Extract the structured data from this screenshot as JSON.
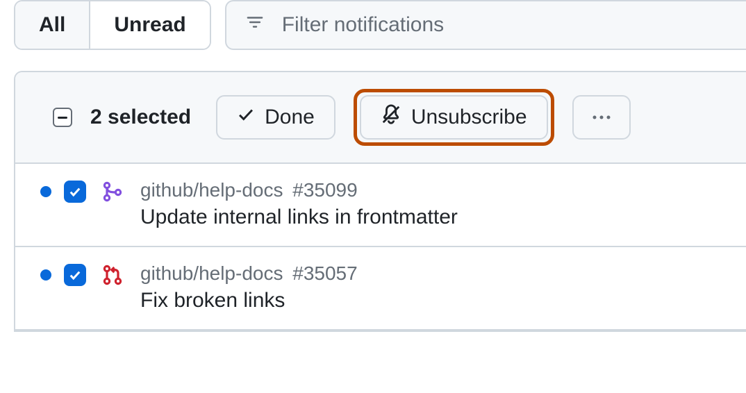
{
  "tabs": {
    "all": "All",
    "unread": "Unread",
    "active": "all"
  },
  "filter": {
    "placeholder": "Filter notifications",
    "value": ""
  },
  "toolbar": {
    "selected_label": "2 selected",
    "done_label": "Done",
    "unsubscribe_label": "Unsubscribe",
    "more_label": "•••"
  },
  "colors": {
    "highlight": "#bc4c00",
    "accent": "#0969da",
    "merged": "#8250df",
    "pr_open": "#cf222e"
  },
  "items": [
    {
      "repo": "github/help-docs",
      "number": "#35099",
      "title": "Update internal links in frontmatter",
      "icon": "git-merge-icon",
      "unread": true,
      "checked": true
    },
    {
      "repo": "github/help-docs",
      "number": "#35057",
      "title": "Fix broken links",
      "icon": "git-pull-request-icon",
      "unread": true,
      "checked": true
    }
  ]
}
